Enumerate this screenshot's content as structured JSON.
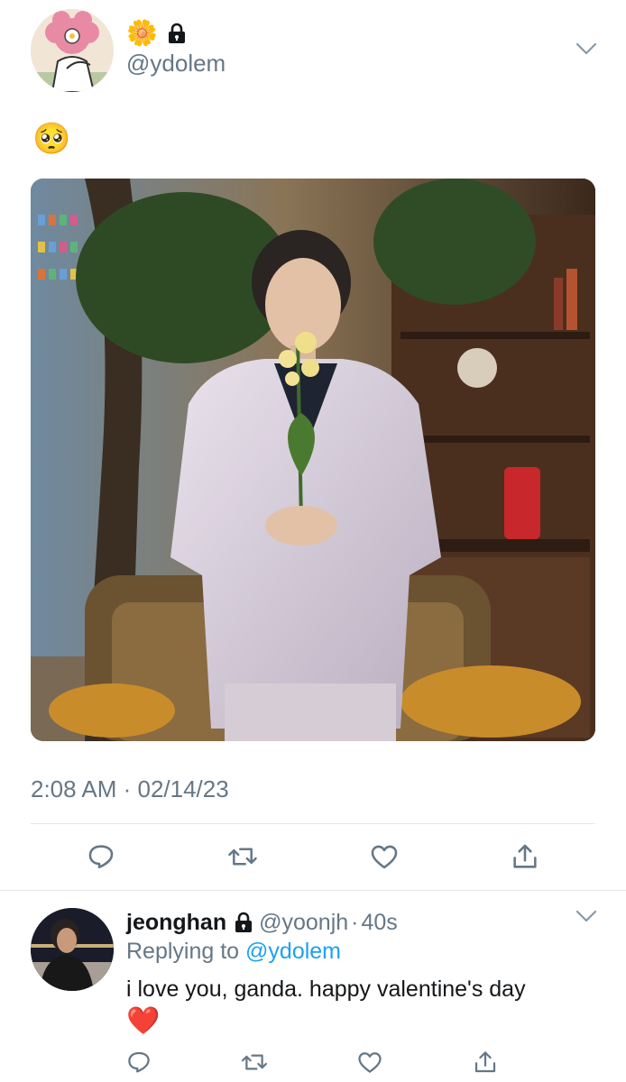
{
  "colors": {
    "accent": "#1da1f2",
    "muted": "#657786",
    "text": "#14171a",
    "divider": "#e1e8ed",
    "heart": "#e0245e"
  },
  "tweet": {
    "name_emoji": "🌼",
    "handle": "@ydolem",
    "body_emoji": "🥺",
    "timestamp": "2:08 AM · 02/14/23",
    "icons": [
      "reply-icon",
      "retweet-icon",
      "like-icon",
      "share-icon"
    ]
  },
  "reply": {
    "name": "jeonghan",
    "handle": "@yoonjh",
    "separator": "·",
    "age": "40s",
    "replying_prefix": "Replying to",
    "replying_handle": "@ydolem",
    "text": "i love you, ganda. happy valentine's day",
    "heart": "❤️"
  }
}
